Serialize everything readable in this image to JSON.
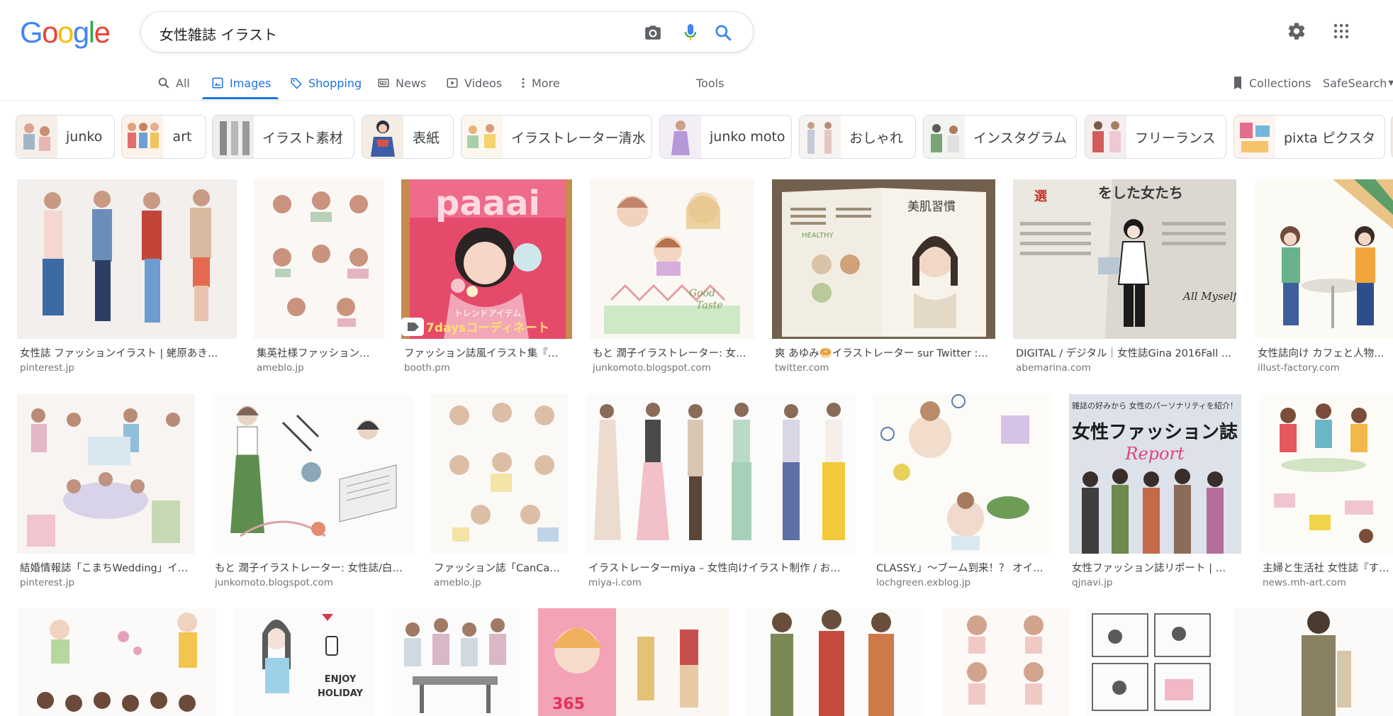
{
  "logo": {
    "letters": [
      "G",
      "o",
      "o",
      "g",
      "l",
      "e"
    ]
  },
  "search": {
    "query": "女性雑誌 イラスト"
  },
  "icons": {
    "camera": "camera-icon",
    "mic": "mic-icon",
    "search": "search-icon",
    "settings": "gear-icon",
    "apps": "apps-grid-icon"
  },
  "tabs": [
    {
      "label": "All",
      "icon": "search-icon"
    },
    {
      "label": "Images",
      "icon": "image-icon"
    },
    {
      "label": "Shopping",
      "icon": "tag-icon"
    },
    {
      "label": "News",
      "icon": "news-icon"
    },
    {
      "label": "Videos",
      "icon": "video-icon"
    },
    {
      "label": "More",
      "icon": "more-vert-icon"
    }
  ],
  "tools_label": "Tools",
  "collections_label": "Collections",
  "safesearch_label": "SafeSearch",
  "chips": [
    "junko",
    "art",
    "イラスト素材",
    "表紙",
    "イラストレーター清水",
    "junko moto",
    "おしゃれ",
    "インスタグラム",
    "フリーランス",
    "pixta ピクスタ"
  ],
  "results_row1": [
    {
      "title": "女性誌 ファッションイラスト | 蛯原あき…",
      "site": "pinterest.jp"
    },
    {
      "title": "集英社様ファッション…",
      "site": "ameblo.jp"
    },
    {
      "title": "ファッション誌風イラスト集『…",
      "site": "booth.pm"
    },
    {
      "title": "もと 潤子イラストレーター: 女…",
      "site": "junkomoto.blogspot.com"
    },
    {
      "title": "爽 あゆみ🥯イラストレーター sur Twitter :…",
      "site": "twitter.com"
    },
    {
      "title": "DIGITAL / デジタル｜女性誌Gina 2016Fall …",
      "site": "abemarina.com"
    },
    {
      "title": "女性誌向け カフェと人物の…",
      "site": "illust-factory.com"
    }
  ],
  "results_row2": [
    {
      "title": "結婚情報誌「こまちWedding」イ…",
      "site": "pinterest.jp"
    },
    {
      "title": "もと 潤子イラストレーター: 女性誌/白…",
      "site": "junkomoto.blogspot.com"
    },
    {
      "title": "ファッション誌「CanCa…",
      "site": "ameblo.jp"
    },
    {
      "title": "イラストレーターmiya – 女性向けイラスト制作 / お…",
      "site": "miya-i.com"
    },
    {
      "title": "CLASSY.」～ブーム到来！？ オイ…",
      "site": "lochgreen.exblog.jp"
    },
    {
      "title": "女性ファッション誌リポート | …",
      "site": "qjnavi.jp"
    },
    {
      "title": "主婦と生活社 女性誌『す…",
      "site": "news.mh-art.com"
    }
  ],
  "image_texts": {
    "magazine_title": "paaai",
    "magazine_footer": "7daysコーディネート",
    "magazine_trend": "トレンドアイテム",
    "beauty_heading": "美肌習慣",
    "healthy": "HEALTHY",
    "article_heading": "をした女たち",
    "all_myself": "All Myself!!",
    "report_lead": "雑誌の好みから 女性のパーソナリティを紹介！",
    "report_title": "女性ファッション誌",
    "report_script": "Report",
    "enjoy": "ENJOY",
    "holiday": "HOLIDAY",
    "good": "Good",
    "taste": "Taste"
  },
  "colors": {
    "accent": "#1a73e8",
    "text": "#202124",
    "muted": "#70757a"
  }
}
